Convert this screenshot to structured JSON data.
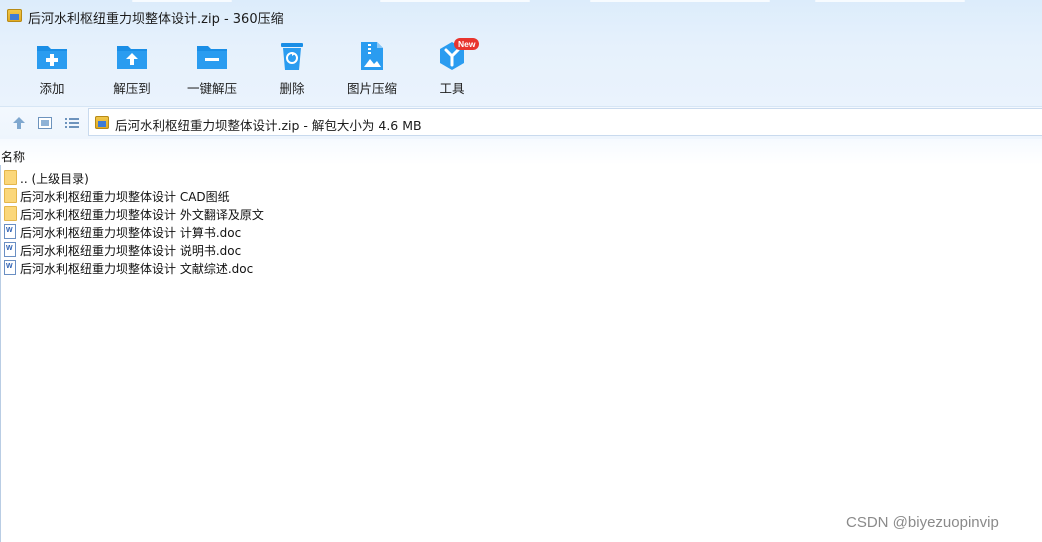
{
  "window": {
    "title": "后河水利枢纽重力坝整体设计.zip - 360压缩"
  },
  "toolbar": {
    "items": [
      {
        "label": "添加",
        "icon": "add-folder-icon"
      },
      {
        "label": "解压到",
        "icon": "extract-to-icon"
      },
      {
        "label": "一键解压",
        "icon": "one-click-extract-icon"
      },
      {
        "label": "删除",
        "icon": "recycle-bin-icon"
      },
      {
        "label": "图片压缩",
        "icon": "image-compress-icon"
      },
      {
        "label": "工具",
        "icon": "tools-icon",
        "badge": "New"
      }
    ]
  },
  "address_bar": {
    "text": "后河水利枢纽重力坝整体设计.zip - 解包大小为 4.6 MB",
    "nav": [
      "up-arrow-icon",
      "thumbnail-view-icon",
      "list-view-icon"
    ]
  },
  "file_list": {
    "column_name": "名称",
    "items": [
      {
        "name": ".. (上级目录)",
        "type": "folder"
      },
      {
        "name": "后河水利枢纽重力坝整体设计 CAD图纸",
        "type": "folder"
      },
      {
        "name": "后河水利枢纽重力坝整体设计 外文翻译及原文",
        "type": "folder"
      },
      {
        "name": "后河水利枢纽重力坝整体设计 计算书.doc",
        "type": "doc"
      },
      {
        "name": "后河水利枢纽重力坝整体设计 说明书.doc",
        "type": "doc"
      },
      {
        "name": "后河水利枢纽重力坝整体设计 文献综述.doc",
        "type": "doc"
      }
    ]
  },
  "watermark": "CSDN @biyezuopinvip",
  "colors": {
    "accent_blue": "#1a8ee6",
    "toolbar_bg": "#e6f1fc",
    "badge_red": "#e8352e"
  }
}
